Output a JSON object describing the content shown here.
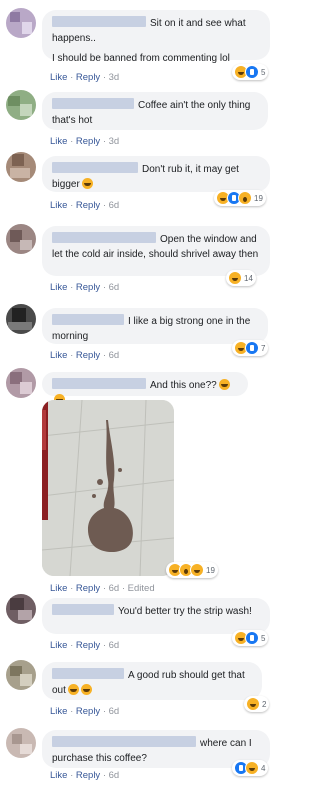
{
  "colors": {
    "bubble": "#f2f3f5",
    "link": "#385898",
    "meta": "#90949c",
    "haha": "#f7b125",
    "like": "#1877f2"
  },
  "actions": {
    "like": "Like",
    "reply": "Reply",
    "sep": "·",
    "edited": "Edited"
  },
  "comments": [
    {
      "text": "Sit on it and see what happens..",
      "text2": "I should be banned from commenting lol",
      "time": "3d",
      "reactions": [
        "haha-icon",
        "like-icon"
      ],
      "count": "5"
    },
    {
      "text": "Coffee ain't the only thing that's hot",
      "time": "3d"
    },
    {
      "text": "Don't rub it, it may get bigger",
      "time": "6d",
      "reactions": [
        "haha-icon",
        "like-icon",
        "wow-icon"
      ],
      "count": "19"
    },
    {
      "text": "Open the window and let the cold air inside, should shrivel away then",
      "time": "6d",
      "reactions": [
        "haha-icon"
      ],
      "count": "14"
    },
    {
      "text": "I like a big strong one in the morning",
      "time": "6d",
      "reactions": [
        "haha-icon",
        "like-icon"
      ],
      "count": "7"
    },
    {
      "text": "And this one??",
      "time": "6d",
      "edited": true,
      "reactions": [
        "haha-icon",
        "wow-icon",
        "haha-icon"
      ],
      "count": "19"
    },
    {
      "text": "You'd better try the strip wash!",
      "time": "6d",
      "reactions": [
        "haha-icon",
        "like-icon"
      ],
      "count": "5"
    },
    {
      "text": "A good rub should get that out",
      "time": "6d",
      "reactions": [
        "haha-icon"
      ],
      "count": "2"
    },
    {
      "text": "where can I purchase this coffee?",
      "time": "6d",
      "reactions": [
        "like-icon",
        "haha-icon"
      ],
      "count": "4"
    }
  ]
}
